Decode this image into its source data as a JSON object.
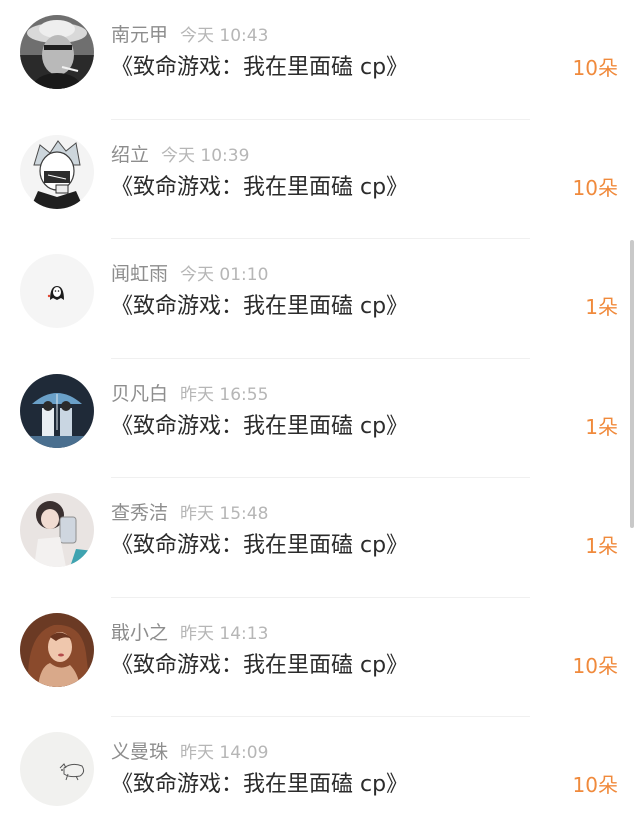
{
  "rows": [
    {
      "name": "南元甲",
      "time": "今天 10:43",
      "title": "《致命游戏：我在里面磕 cp》",
      "amount": "10朵",
      "avatar_icon": "man-with-hat-avatar"
    },
    {
      "name": "绍立",
      "time": "今天 10:39",
      "title": "《致命游戏：我在里面磕 cp》",
      "amount": "10朵",
      "avatar_icon": "anime-boy-avatar"
    },
    {
      "name": "闻虹雨",
      "time": "今天 01:10",
      "title": "《致命游戏：我在里面磕 cp》",
      "amount": "1朵",
      "avatar_icon": "small-ghost-avatar"
    },
    {
      "name": "贝凡白",
      "time": "昨天 16:55",
      "title": "《致命游戏：我在里面磕 cp》",
      "amount": "1朵",
      "avatar_icon": "umbrella-couple-avatar"
    },
    {
      "name": "查秀洁",
      "time": "昨天 15:48",
      "title": "《致命游戏：我在里面磕 cp》",
      "amount": "1朵",
      "avatar_icon": "selfie-girl-avatar"
    },
    {
      "name": "戢小之",
      "time": "昨天 14:13",
      "title": "《致命游戏：我在里面磕 cp》",
      "amount": "10朵",
      "avatar_icon": "long-hair-woman-avatar"
    },
    {
      "name": "义曼珠",
      "time": "昨天 14:09",
      "title": "《致命游戏：我在里面磕 cp》",
      "amount": "10朵",
      "avatar_icon": "sketch-cat-avatar"
    }
  ],
  "colors": {
    "name": "#8d8d8d",
    "time": "#b6b6b6",
    "title": "#2b2b2b",
    "amount": "#f08a3c",
    "divider": "#f0f0f0"
  }
}
